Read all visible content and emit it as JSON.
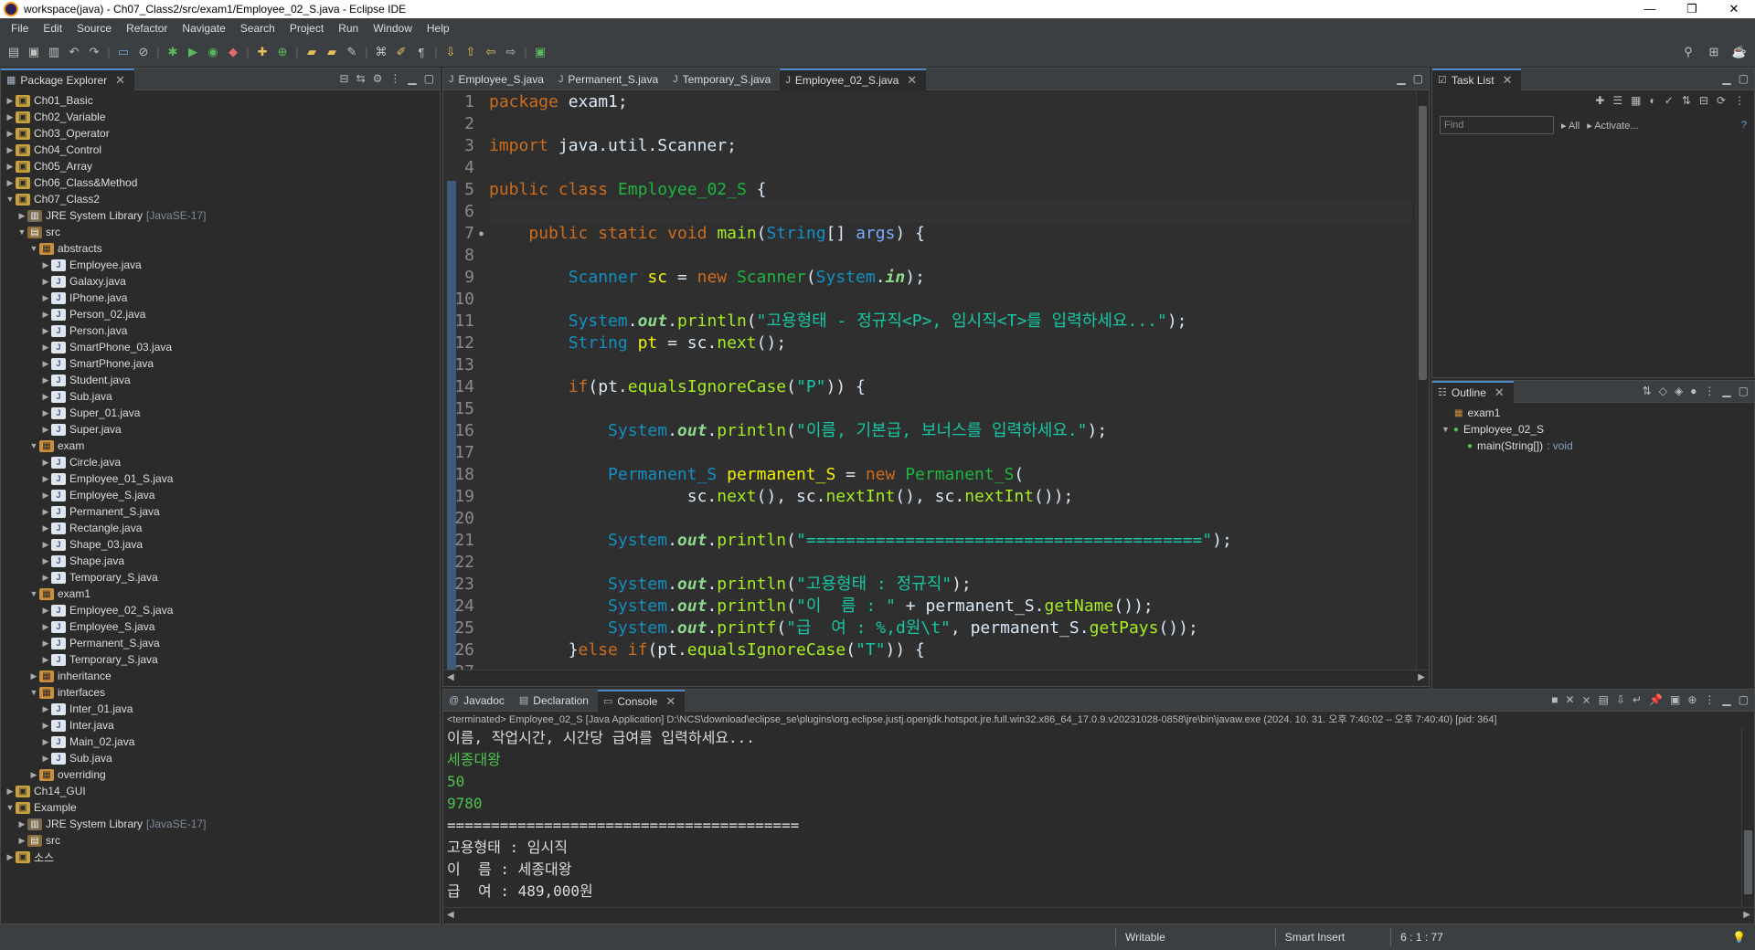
{
  "window": {
    "title": "workspace(java) - Ch07_Class2/src/exam1/Employee_02_S.java - Eclipse IDE",
    "minimize": "—",
    "restore": "❐",
    "close": "✕"
  },
  "menu": [
    "File",
    "Edit",
    "Source",
    "Refactor",
    "Navigate",
    "Search",
    "Project",
    "Run",
    "Window",
    "Help"
  ],
  "package_explorer": {
    "title": "Package Explorer",
    "tree": [
      {
        "label": "Ch01_Basic",
        "depth": 0,
        "expanded": false,
        "kind": "proj"
      },
      {
        "label": "Ch02_Variable",
        "depth": 0,
        "expanded": false,
        "kind": "proj"
      },
      {
        "label": "Ch03_Operator",
        "depth": 0,
        "expanded": false,
        "kind": "proj"
      },
      {
        "label": "Ch04_Control",
        "depth": 0,
        "expanded": false,
        "kind": "proj"
      },
      {
        "label": "Ch05_Array",
        "depth": 0,
        "expanded": false,
        "kind": "proj"
      },
      {
        "label": "Ch06_Class&Method",
        "depth": 0,
        "expanded": false,
        "kind": "proj"
      },
      {
        "label": "Ch07_Class2",
        "depth": 0,
        "expanded": true,
        "kind": "proj"
      },
      {
        "label": "JRE System Library",
        "decoration": "[JavaSE-17]",
        "depth": 1,
        "expanded": false,
        "kind": "lib"
      },
      {
        "label": "src",
        "depth": 1,
        "expanded": true,
        "kind": "src"
      },
      {
        "label": "abstracts",
        "depth": 2,
        "expanded": true,
        "kind": "pkg"
      },
      {
        "label": "Employee.java",
        "depth": 3,
        "expanded": false,
        "kind": "java"
      },
      {
        "label": "Galaxy.java",
        "depth": 3,
        "expanded": false,
        "kind": "java"
      },
      {
        "label": "IPhone.java",
        "depth": 3,
        "expanded": false,
        "kind": "java"
      },
      {
        "label": "Person_02.java",
        "depth": 3,
        "expanded": false,
        "kind": "java"
      },
      {
        "label": "Person.java",
        "depth": 3,
        "expanded": false,
        "kind": "java"
      },
      {
        "label": "SmartPhone_03.java",
        "depth": 3,
        "expanded": false,
        "kind": "java"
      },
      {
        "label": "SmartPhone.java",
        "depth": 3,
        "expanded": false,
        "kind": "java"
      },
      {
        "label": "Student.java",
        "depth": 3,
        "expanded": false,
        "kind": "java"
      },
      {
        "label": "Sub.java",
        "depth": 3,
        "expanded": false,
        "kind": "java"
      },
      {
        "label": "Super_01.java",
        "depth": 3,
        "expanded": false,
        "kind": "java"
      },
      {
        "label": "Super.java",
        "depth": 3,
        "expanded": false,
        "kind": "java"
      },
      {
        "label": "exam",
        "depth": 2,
        "expanded": true,
        "kind": "pkg"
      },
      {
        "label": "Circle.java",
        "depth": 3,
        "expanded": false,
        "kind": "java"
      },
      {
        "label": "Employee_01_S.java",
        "depth": 3,
        "expanded": false,
        "kind": "java"
      },
      {
        "label": "Employee_S.java",
        "depth": 3,
        "expanded": false,
        "kind": "java"
      },
      {
        "label": "Permanent_S.java",
        "depth": 3,
        "expanded": false,
        "kind": "java"
      },
      {
        "label": "Rectangle.java",
        "depth": 3,
        "expanded": false,
        "kind": "java"
      },
      {
        "label": "Shape_03.java",
        "depth": 3,
        "expanded": false,
        "kind": "java"
      },
      {
        "label": "Shape.java",
        "depth": 3,
        "expanded": false,
        "kind": "java"
      },
      {
        "label": "Temporary_S.java",
        "depth": 3,
        "expanded": false,
        "kind": "java"
      },
      {
        "label": "exam1",
        "depth": 2,
        "expanded": true,
        "kind": "pkg"
      },
      {
        "label": "Employee_02_S.java",
        "depth": 3,
        "expanded": false,
        "kind": "java"
      },
      {
        "label": "Employee_S.java",
        "depth": 3,
        "expanded": false,
        "kind": "java"
      },
      {
        "label": "Permanent_S.java",
        "depth": 3,
        "expanded": false,
        "kind": "java"
      },
      {
        "label": "Temporary_S.java",
        "depth": 3,
        "expanded": false,
        "kind": "java"
      },
      {
        "label": "inheritance",
        "depth": 2,
        "expanded": false,
        "kind": "pkg"
      },
      {
        "label": "interfaces",
        "depth": 2,
        "expanded": true,
        "kind": "pkg"
      },
      {
        "label": "Inter_01.java",
        "depth": 3,
        "expanded": false,
        "kind": "java"
      },
      {
        "label": "Inter.java",
        "depth": 3,
        "expanded": false,
        "kind": "java"
      },
      {
        "label": "Main_02.java",
        "depth": 3,
        "expanded": false,
        "kind": "java"
      },
      {
        "label": "Sub.java",
        "depth": 3,
        "expanded": false,
        "kind": "java"
      },
      {
        "label": "overriding",
        "depth": 2,
        "expanded": false,
        "kind": "pkg"
      },
      {
        "label": "Ch14_GUI",
        "depth": 0,
        "expanded": false,
        "kind": "proj"
      },
      {
        "label": "Example",
        "depth": 0,
        "expanded": true,
        "kind": "proj"
      },
      {
        "label": "JRE System Library",
        "decoration": "[JavaSE-17]",
        "depth": 1,
        "expanded": false,
        "kind": "lib"
      },
      {
        "label": "src",
        "depth": 1,
        "expanded": false,
        "kind": "src"
      },
      {
        "label": "소스",
        "depth": 0,
        "expanded": false,
        "kind": "proj"
      }
    ]
  },
  "editor": {
    "tabs": [
      {
        "label": "Employee_S.java",
        "active": false
      },
      {
        "label": "Permanent_S.java",
        "active": false
      },
      {
        "label": "Temporary_S.java",
        "active": false
      },
      {
        "label": "Employee_02_S.java",
        "active": true
      }
    ],
    "current_line": 6,
    "lines": [
      [
        [
          "kw",
          "package"
        ],
        [
          "pl",
          " exam1;"
        ]
      ],
      [],
      [
        [
          "kw",
          "import"
        ],
        [
          "pl",
          " java.util.Scanner;"
        ]
      ],
      [],
      [
        [
          "kw",
          "public"
        ],
        [
          "pl",
          " "
        ],
        [
          "kw",
          "class"
        ],
        [
          "pl",
          " "
        ],
        [
          "cls",
          "Employee_02_S"
        ],
        [
          "pl",
          " {"
        ]
      ],
      [],
      [
        [
          "pl",
          "    "
        ],
        [
          "kw",
          "public"
        ],
        [
          "pl",
          " "
        ],
        [
          "kw",
          "static"
        ],
        [
          "pl",
          " "
        ],
        [
          "kw",
          "void"
        ],
        [
          "pl",
          " "
        ],
        [
          "mth",
          "main"
        ],
        [
          "pl",
          "("
        ],
        [
          "ty",
          "String"
        ],
        [
          "pl",
          "[] "
        ],
        [
          "par",
          "args"
        ],
        [
          "pl",
          ") {"
        ]
      ],
      [],
      [
        [
          "pl",
          "        "
        ],
        [
          "ty",
          "Scanner"
        ],
        [
          "pl",
          " "
        ],
        [
          "var",
          "sc"
        ],
        [
          "pl",
          " = "
        ],
        [
          "kw",
          "new"
        ],
        [
          "pl",
          " "
        ],
        [
          "cls",
          "Scanner"
        ],
        [
          "pl",
          "("
        ],
        [
          "ty",
          "System"
        ],
        [
          "pl",
          "."
        ],
        [
          "fld",
          "in"
        ],
        [
          "pl",
          ");"
        ]
      ],
      [],
      [
        [
          "pl",
          "        "
        ],
        [
          "ty",
          "System"
        ],
        [
          "pl",
          "."
        ],
        [
          "fld",
          "out"
        ],
        [
          "pl",
          "."
        ],
        [
          "mth",
          "println"
        ],
        [
          "pl",
          "("
        ],
        [
          "str",
          "\"고용형태 - 정규직<P>, 임시직<T>를 입력하세요...\""
        ],
        [
          "pl",
          ");"
        ]
      ],
      [
        [
          "pl",
          "        "
        ],
        [
          "ty",
          "String"
        ],
        [
          "pl",
          " "
        ],
        [
          "var",
          "pt"
        ],
        [
          "pl",
          " = sc."
        ],
        [
          "mth",
          "next"
        ],
        [
          "pl",
          "();"
        ]
      ],
      [],
      [
        [
          "pl",
          "        "
        ],
        [
          "kw",
          "if"
        ],
        [
          "pl",
          "(pt."
        ],
        [
          "mth",
          "equalsIgnoreCase"
        ],
        [
          "pl",
          "("
        ],
        [
          "str",
          "\"P\""
        ],
        [
          "pl",
          ")) {"
        ]
      ],
      [],
      [
        [
          "pl",
          "            "
        ],
        [
          "ty",
          "System"
        ],
        [
          "pl",
          "."
        ],
        [
          "fld",
          "out"
        ],
        [
          "pl",
          "."
        ],
        [
          "mth",
          "println"
        ],
        [
          "pl",
          "("
        ],
        [
          "str",
          "\"이름, 기본급, 보너스를 입력하세요.\""
        ],
        [
          "pl",
          ");"
        ]
      ],
      [],
      [
        [
          "pl",
          "            "
        ],
        [
          "ty",
          "Permanent_S"
        ],
        [
          "pl",
          " "
        ],
        [
          "var",
          "permanent_S"
        ],
        [
          "pl",
          " = "
        ],
        [
          "kw",
          "new"
        ],
        [
          "pl",
          " "
        ],
        [
          "cls",
          "Permanent_S"
        ],
        [
          "pl",
          "("
        ]
      ],
      [
        [
          "pl",
          "                    sc."
        ],
        [
          "mth",
          "next"
        ],
        [
          "pl",
          "(), sc."
        ],
        [
          "mth",
          "nextInt"
        ],
        [
          "pl",
          "(), sc."
        ],
        [
          "mth",
          "nextInt"
        ],
        [
          "pl",
          "());"
        ]
      ],
      [],
      [
        [
          "pl",
          "            "
        ],
        [
          "ty",
          "System"
        ],
        [
          "pl",
          "."
        ],
        [
          "fld",
          "out"
        ],
        [
          "pl",
          "."
        ],
        [
          "mth",
          "println"
        ],
        [
          "pl",
          "("
        ],
        [
          "str",
          "\"========================================\""
        ],
        [
          "pl",
          ");"
        ]
      ],
      [],
      [
        [
          "pl",
          "            "
        ],
        [
          "ty",
          "System"
        ],
        [
          "pl",
          "."
        ],
        [
          "fld",
          "out"
        ],
        [
          "pl",
          "."
        ],
        [
          "mth",
          "println"
        ],
        [
          "pl",
          "("
        ],
        [
          "str",
          "\"고용형태 : 정규직\""
        ],
        [
          "pl",
          ");"
        ]
      ],
      [
        [
          "pl",
          "            "
        ],
        [
          "ty",
          "System"
        ],
        [
          "pl",
          "."
        ],
        [
          "fld",
          "out"
        ],
        [
          "pl",
          "."
        ],
        [
          "mth",
          "println"
        ],
        [
          "pl",
          "("
        ],
        [
          "str",
          "\"이  름 : \""
        ],
        [
          "pl",
          " + permanent_S."
        ],
        [
          "mth",
          "getName"
        ],
        [
          "pl",
          "());"
        ]
      ],
      [
        [
          "pl",
          "            "
        ],
        [
          "ty",
          "System"
        ],
        [
          "pl",
          "."
        ],
        [
          "fld",
          "out"
        ],
        [
          "pl",
          "."
        ],
        [
          "mth",
          "printf"
        ],
        [
          "pl",
          "("
        ],
        [
          "str",
          "\"급  여 : %,d원\\t\""
        ],
        [
          "pl",
          ", permanent_S."
        ],
        [
          "mth",
          "getPays"
        ],
        [
          "pl",
          "());"
        ]
      ],
      [
        [
          "pl",
          "        }"
        ],
        [
          "kw",
          "else"
        ],
        [
          "pl",
          " "
        ],
        [
          "kw",
          "if"
        ],
        [
          "pl",
          "(pt."
        ],
        [
          "mth",
          "equalsIgnoreCase"
        ],
        [
          "pl",
          "("
        ],
        [
          "str",
          "\"T\""
        ],
        [
          "pl",
          ")) {"
        ]
      ],
      []
    ]
  },
  "task_list": {
    "title": "Task List",
    "find_placeholder": "Find",
    "all_label": "All",
    "activate_label": "Activate..."
  },
  "outline": {
    "title": "Outline",
    "items": [
      {
        "label": "exam1",
        "depth": 0,
        "kind": "pkg"
      },
      {
        "label": "Employee_02_S",
        "depth": 0,
        "kind": "class"
      },
      {
        "label": "main(String[])",
        "ret": ": void",
        "depth": 1,
        "kind": "method"
      }
    ]
  },
  "bottom": {
    "tabs": [
      {
        "label": "Javadoc",
        "active": false
      },
      {
        "label": "Declaration",
        "active": false
      },
      {
        "label": "Console",
        "active": true
      }
    ],
    "terminated": "<terminated> Employee_02_S [Java Application] D:\\NCS\\download\\eclipse_se\\plugins\\org.eclipse.justj.openjdk.hotspot.jre.full.win32.x86_64_17.0.9.v20231028-0858\\jre\\bin\\javaw.exe  (2024. 10. 31. 오후 7:40:02 – 오후 7:40:40) [pid: 364]",
    "output": [
      {
        "text": "이름, 작업시간, 시간당 급여를 입력하세요...",
        "kind": "out"
      },
      {
        "text": "세종대왕",
        "kind": "in"
      },
      {
        "text": "50",
        "kind": "in"
      },
      {
        "text": "9780",
        "kind": "in"
      },
      {
        "text": "========================================",
        "kind": "out"
      },
      {
        "text": "고용형태 : 임시직",
        "kind": "out"
      },
      {
        "text": "이  름 : 세종대왕",
        "kind": "out"
      },
      {
        "text": "급  여 : 489,000원",
        "kind": "out"
      }
    ]
  },
  "status": {
    "writable": "Writable",
    "insert_mode": "Smart Insert",
    "position": "6 : 1 : 77"
  }
}
